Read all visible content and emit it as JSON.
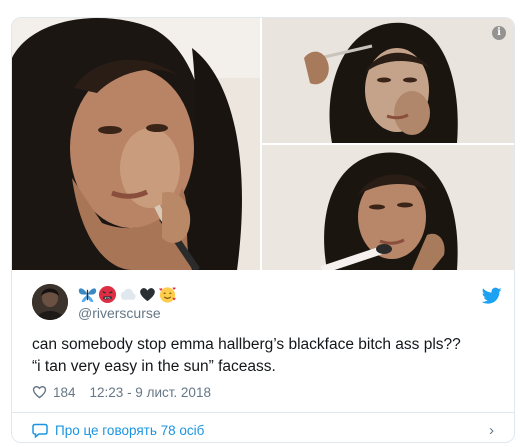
{
  "tweet": {
    "user": {
      "handle": "@riverscurse",
      "name_emojis": [
        "butterfly-icon",
        "angry-face-icon",
        "cloud-icon",
        "black-heart-icon",
        "smiling-face-with-hearts-icon"
      ]
    },
    "text_line1": "can somebody stop emma hallberg’s blackface bitch ass pls??",
    "text_line2": "“i tan very easy in the sun” faceass.",
    "likes": "184",
    "timestamp": "12:23 - 9 лист. 2018",
    "footer_link": "Про це говорять 78 осіб",
    "info_label": "i"
  },
  "colors": {
    "accent": "#1b95e0",
    "text": "#14171a",
    "muted": "#657786",
    "border": "#e1e8ed",
    "twitter_blue": "#1da1f2"
  }
}
